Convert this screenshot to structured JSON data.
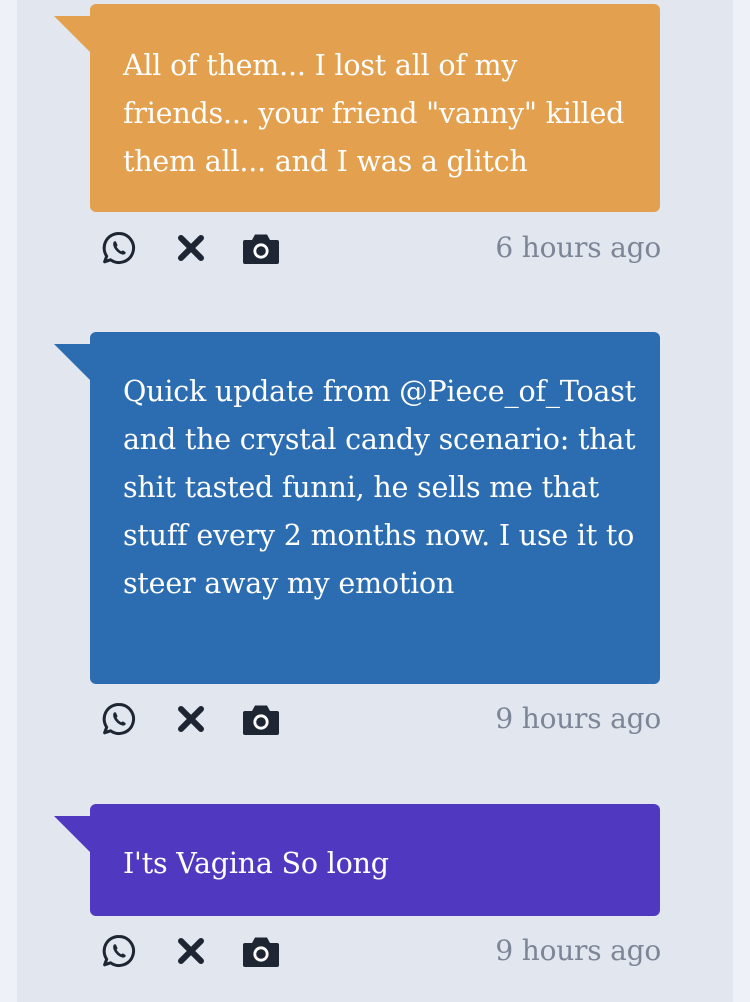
{
  "colors": {
    "page_background": "#eef1f8",
    "feed_background": "#e2e6ef",
    "orange": "#e3a14f",
    "blue": "#2c6cb1",
    "purple": "#5038c0",
    "icon": "#1e2633",
    "timestamp": "#7d8697"
  },
  "posts": [
    {
      "color": "orange",
      "text": "All of them... I lost all of my friends... your friend \"vanny\" killed them all... and I was a glitch",
      "timestamp": "6 hours ago",
      "actions": [
        "whatsapp-share-icon",
        "x-share-icon",
        "camera-icon"
      ]
    },
    {
      "color": "blue",
      "text": "Quick update from @Piece_of_Toast and the crystal candy scenario: that shit tasted funni, he sells me that stuff every 2 months now. I use it to steer away my emotion",
      "timestamp": "9 hours ago",
      "actions": [
        "whatsapp-share-icon",
        "x-share-icon",
        "camera-icon"
      ]
    },
    {
      "color": "purple",
      "text": "I'ts Vagina So long",
      "timestamp": "9 hours ago",
      "actions": [
        "whatsapp-share-icon",
        "x-share-icon",
        "camera-icon"
      ]
    }
  ]
}
